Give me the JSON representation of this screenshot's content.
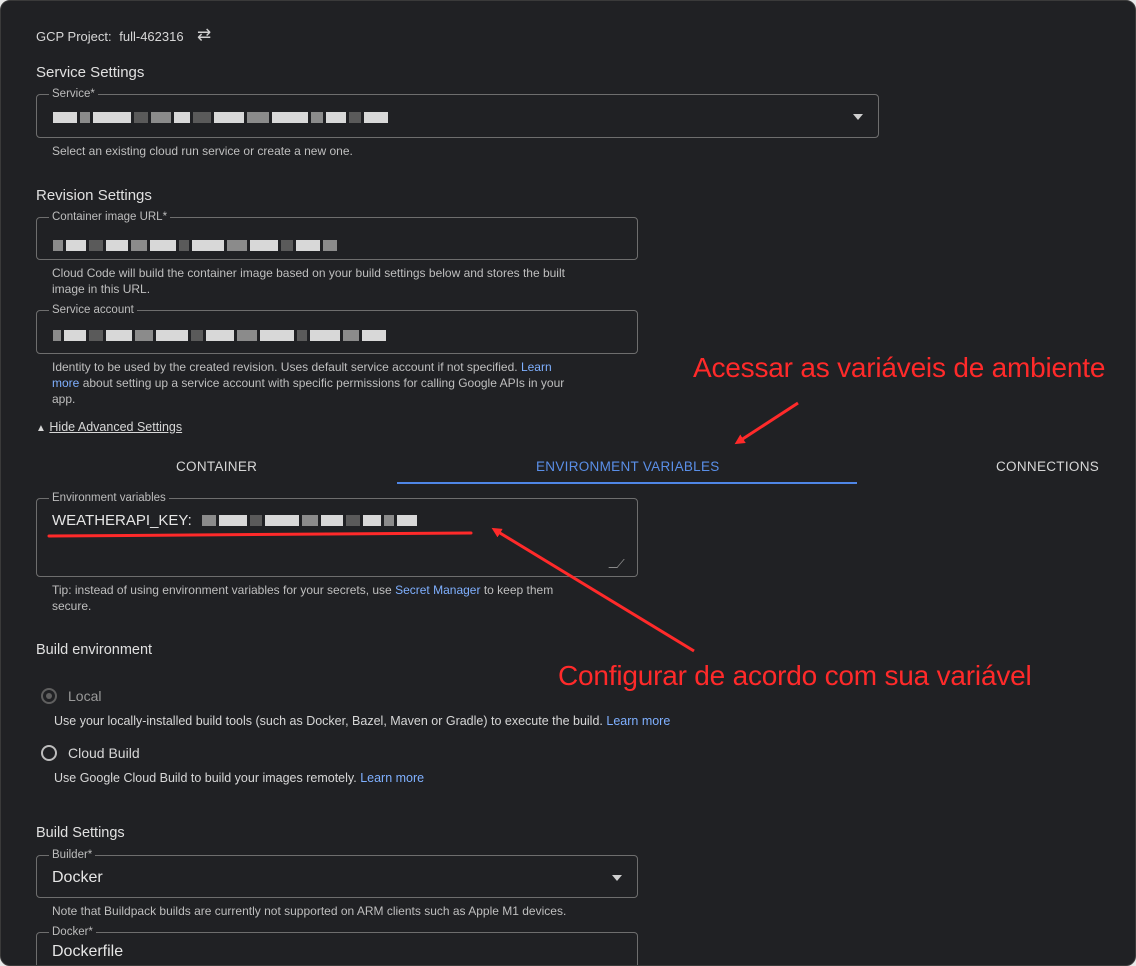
{
  "project": {
    "label": "GCP Project:",
    "value": "full-462316",
    "switch_icon": "swap-icon"
  },
  "service_settings": {
    "heading": "Service Settings",
    "service_label": "Service*",
    "service_helper": "Select an existing cloud run service or create a new one."
  },
  "revision_settings": {
    "heading": "Revision Settings",
    "image_label": "Container image URL*",
    "image_helper_1": "Cloud Code will build the container image based on your build settings below and stores the built",
    "image_helper_2": "image in this URL.",
    "account_label": "Service account",
    "account_helper_1": "Identity to be used by the created revision. Uses default service account if not specified.",
    "account_helper_link_1": "Learn",
    "account_helper_link_2": "more",
    "account_helper_2": "about setting up a service account with specific permissions for calling Google APIs in your",
    "account_helper_3": "app."
  },
  "advanced": {
    "toggle_label": "Hide Advanced Settings",
    "icon": "triangle-up-icon"
  },
  "tabs": [
    {
      "label": "CONTAINER",
      "active": false
    },
    {
      "label": "ENVIRONMENT VARIABLES",
      "active": true
    },
    {
      "label": "CONNECTIONS",
      "active": false
    }
  ],
  "env": {
    "label": "Environment variables",
    "value_prefix": "WEATHERAPI_KEY:",
    "tip_1": "Tip: instead of using environment variables for your secrets, use",
    "tip_link": "Secret Manager",
    "tip_2": "to keep them",
    "tip_3": "secure."
  },
  "build_env": {
    "heading": "Build environment",
    "local_label": "Local",
    "local_desc": "Use your locally-installed build tools (such as Docker, Bazel, Maven or Gradle) to execute the build.",
    "local_link": "Learn more",
    "cloud_label": "Cloud Build",
    "cloud_desc": "Use Google Cloud Build to build your images remotely.",
    "cloud_link": "Learn more"
  },
  "build_settings": {
    "heading": "Build Settings",
    "builder_label": "Builder*",
    "builder_value": "Docker",
    "builder_note": "Note that Buildpack builds are currently not supported on ARM clients such as Apple M1 devices.",
    "dockerfile_label": "Docker*",
    "dockerfile_value": "Dockerfile"
  },
  "annotations": {
    "top": "Acessar as variáveis de ambiente",
    "bottom": "Configurar de acordo com sua variável"
  },
  "colors": {
    "accent": "#4f86e6",
    "annotation": "#ff2a2a",
    "background": "#202124"
  }
}
